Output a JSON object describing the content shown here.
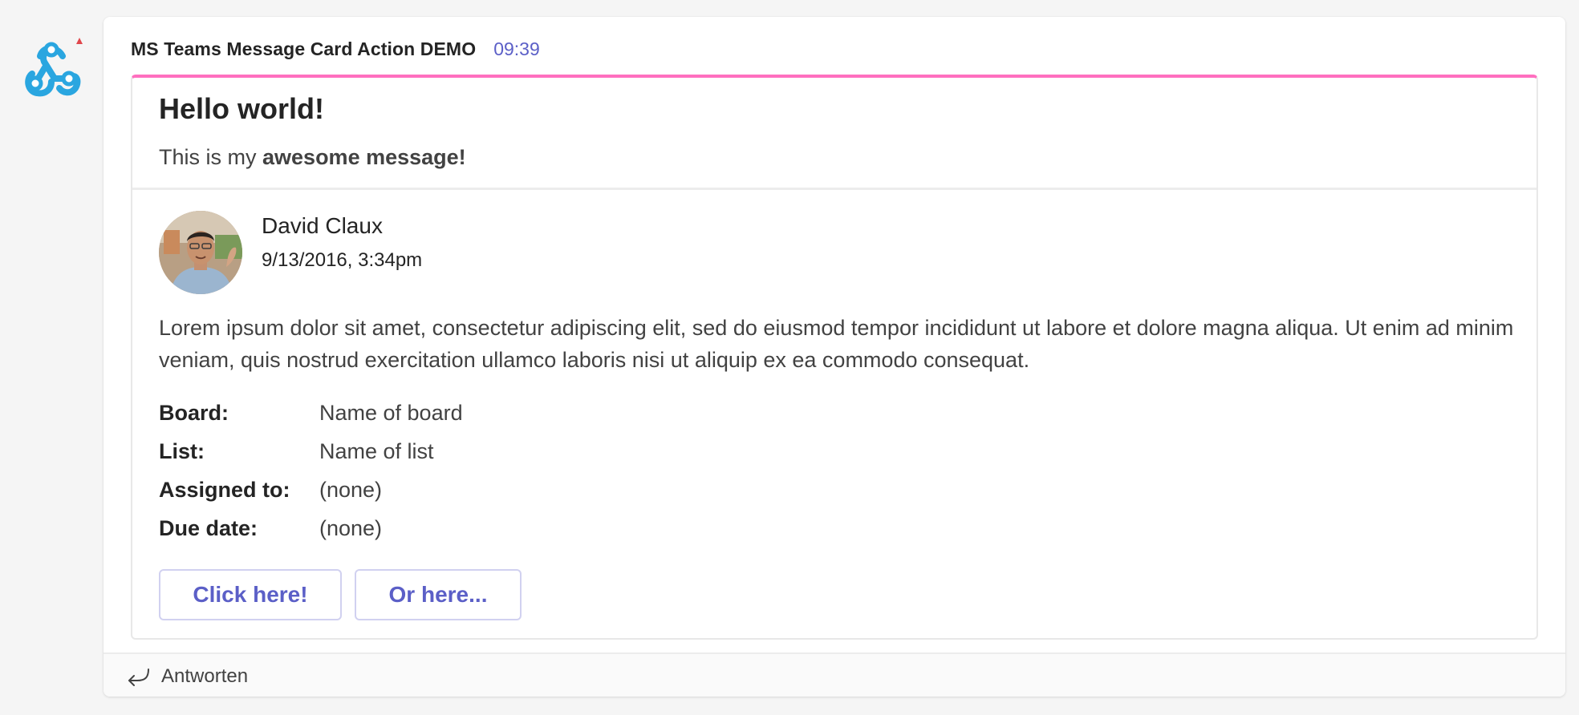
{
  "message": {
    "sender": "MS Teams Message Card Action DEMO",
    "time": "09:39",
    "reply_label": "Antworten"
  },
  "card": {
    "accent_color": "#ff6fbf",
    "title": "Hello world!",
    "text_prefix": "This is my ",
    "text_bold": "awesome message!",
    "activity": {
      "name": "David Claux",
      "date": "9/13/2016, 3:34pm"
    },
    "body": "Lorem ipsum dolor sit amet, consectetur adipiscing elit, sed do eiusmod tempor incididunt ut labore et dolore magna aliqua. Ut enim ad minim veniam, quis nostrud exercitation ullamco laboris nisi ut aliquip ex ea commodo consequat.",
    "facts": [
      {
        "name": "Board:",
        "value": "Name of board"
      },
      {
        "name": "List:",
        "value": "Name of list"
      },
      {
        "name": "Assigned to:",
        "value": "(none)"
      },
      {
        "name": "Due date:",
        "value": "(none)"
      }
    ],
    "actions": [
      "Click here!",
      "Or here..."
    ]
  },
  "icons": {
    "bot": "webhook-icon",
    "reply": "reply-arrow-icon"
  },
  "colors": {
    "accent": "#5b5fc7",
    "webhook_blue": "#2aa6e0"
  }
}
